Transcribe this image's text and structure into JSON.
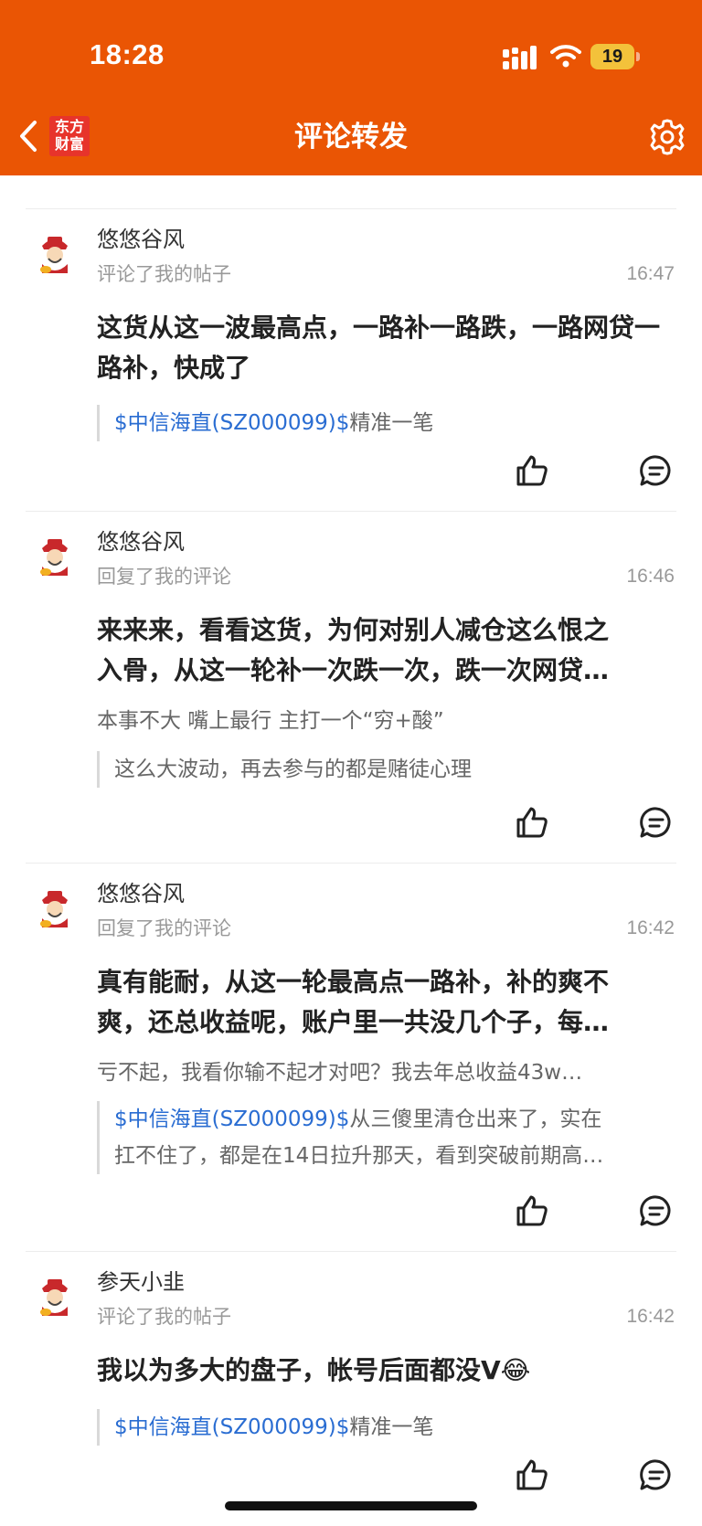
{
  "status_bar": {
    "time": "18:28",
    "battery": "19"
  },
  "header": {
    "title": "评论转发",
    "logo_line1": "东方",
    "logo_line2": "财富"
  },
  "items": [
    {
      "name": "悠悠谷风",
      "action": "评论了我的帖子",
      "time": "16:47",
      "content": "这货从这一波最高点，一路补一路跌，一路网贷一路补，快成了",
      "quote_stock": "$中信海直(SZ000099)$",
      "quote_text": "精准一笔"
    },
    {
      "name": "悠悠谷风",
      "action": "回复了我的评论",
      "time": "16:46",
      "content_line1": "来来来，看看这货，为何对别人减仓这么恨之",
      "content_line2": "入骨，从这一轮补一次跌一次，跌一次网贷…",
      "reply": "本事不大 嘴上最行 主打一个“穷+酸”",
      "quote_text": "这么大波动，再去参与的都是赌徒心理"
    },
    {
      "name": "悠悠谷风",
      "action": "回复了我的评论",
      "time": "16:42",
      "content_line1": "真有能耐，从这一轮最高点一路补，补的爽不",
      "content_line2": "爽，还总收益呢，账户里一共没几个子，每…",
      "reply": "亏不起，我看你输不起才对吧？我去年总收益43w…",
      "quote_stock": "$中信海直(SZ000099)$",
      "quote_text_line1": "从三傻里清仓出来了，实在",
      "quote_text_line2": "扛不住了，都是在14日拉升那天，看到突破前期高…"
    },
    {
      "name": "参天小韭",
      "action": "评论了我的帖子",
      "time": "16:42",
      "content": "我以为多大的盘子，帐号后面都没V😂",
      "quote_stock": "$中信海直(SZ000099)$",
      "quote_text": "精准一笔"
    }
  ],
  "colors": {
    "brand": "#EA5504",
    "link": "#2A6DD2",
    "battery": "#F3C23B"
  },
  "icons": [
    "chevron-left-icon",
    "gear-icon",
    "thumbs-up-icon",
    "comment-icon",
    "avatar-icon"
  ]
}
